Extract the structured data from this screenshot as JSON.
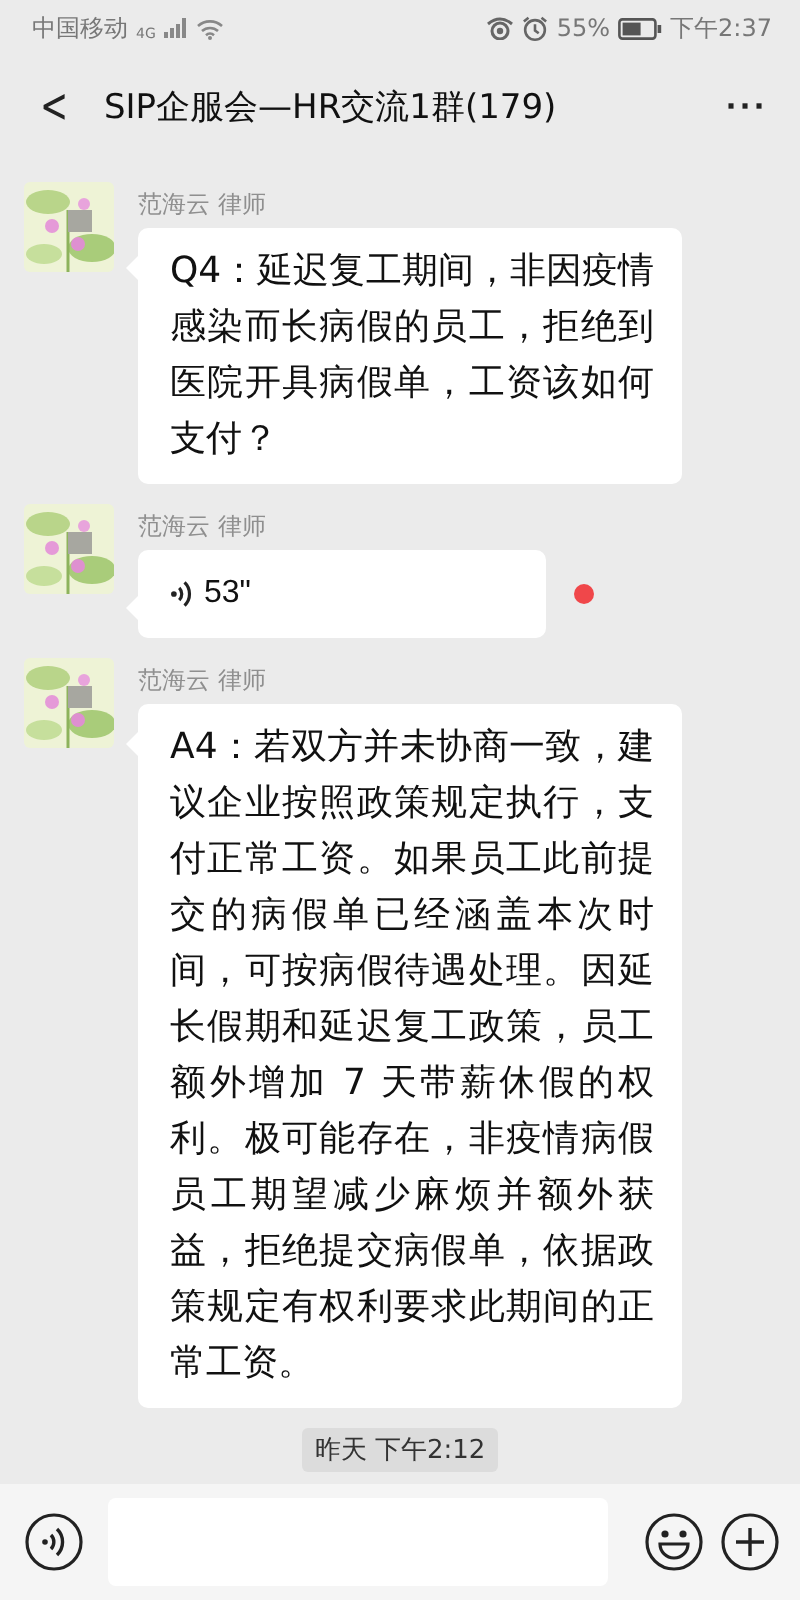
{
  "status_bar": {
    "carrier": "中国移动",
    "network": "4G",
    "battery": "55%",
    "time": "下午2:37"
  },
  "header": {
    "back": "<",
    "title": "SIP企服会—HR交流1群(179)",
    "more": "···"
  },
  "messages": [
    {
      "kind": "text",
      "sender": "范海云 律师",
      "text": "Q4：延迟复工期间，非因疫情感染而长病假的员工，拒绝到医院开具病假单，工资该如何支付？"
    },
    {
      "kind": "voice",
      "sender": "范海云 律师",
      "duration": "53\"",
      "unread": true
    },
    {
      "kind": "text",
      "sender": "范海云 律师",
      "text": "A4：若双方并未协商一致，建议企业按照政策规定执行，支付正常工资。如果员工此前提交的病假单已经涵盖本次时间，可按病假待遇处理。因延长假期和延迟复工政策，员工额外增加 7 天带薪休假的权利。极可能存在，非疫情病假员工期望减少麻烦并额外获益，拒绝提交病假单，依据政策规定有权利要求此期间的正常工资。"
    },
    {
      "kind": "time",
      "text": "昨天 下午2:12"
    }
  ]
}
